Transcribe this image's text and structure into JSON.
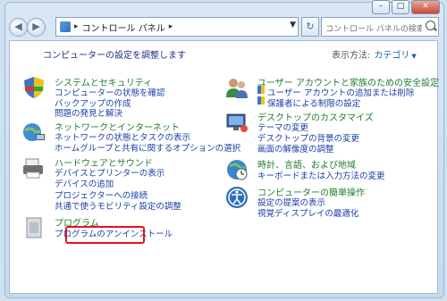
{
  "address": {
    "path": "コントロール パネル",
    "sep1": "▸",
    "sep2": "▸"
  },
  "search": {
    "placeholder": "コントロール パネルの検索"
  },
  "header": {
    "title": "コンピューターの設定を調整します",
    "view_by_label": "表示方法:",
    "view_by_value": "カテゴリ"
  },
  "left": [
    {
      "title": "システムとセキュリティ",
      "links": [
        "コンピューターの状態を確認",
        "バックアップの作成",
        "問題の発見と解決"
      ]
    },
    {
      "title": "ネットワークとインターネット",
      "links": [
        "ネットワークの状態とタスクの表示",
        "ホームグループと共有に関するオプションの選択"
      ]
    },
    {
      "title": "ハードウェアとサウンド",
      "links": [
        "デバイスとプリンターの表示",
        "デバイスの追加",
        "プロジェクターへの接続",
        "共通で使うモビリティ設定の調整"
      ]
    },
    {
      "title": "プログラム",
      "links": [
        "プログラムのアンインストール"
      ]
    }
  ],
  "right": [
    {
      "title": "ユーザー アカウントと家族のための安全設定",
      "links": [
        "ユーザー アカウントの追加または削除",
        "保護者による制限の設定"
      ]
    },
    {
      "title": "デスクトップのカスタマイズ",
      "links": [
        "テーマの変更",
        "デスクトップの背景の変更",
        "画面の解像度の調整"
      ]
    },
    {
      "title": "時計、言語、および地域",
      "links": [
        "キーボードまたは入力方法の変更"
      ]
    },
    {
      "title": "コンピューターの簡単操作",
      "links": [
        "設定の提案の表示",
        "視覚ディスプレイの最適化"
      ]
    }
  ],
  "colors": {
    "category_title": "#1e7d2d",
    "link": "#1a3fa8",
    "highlight": "#e8101a"
  }
}
